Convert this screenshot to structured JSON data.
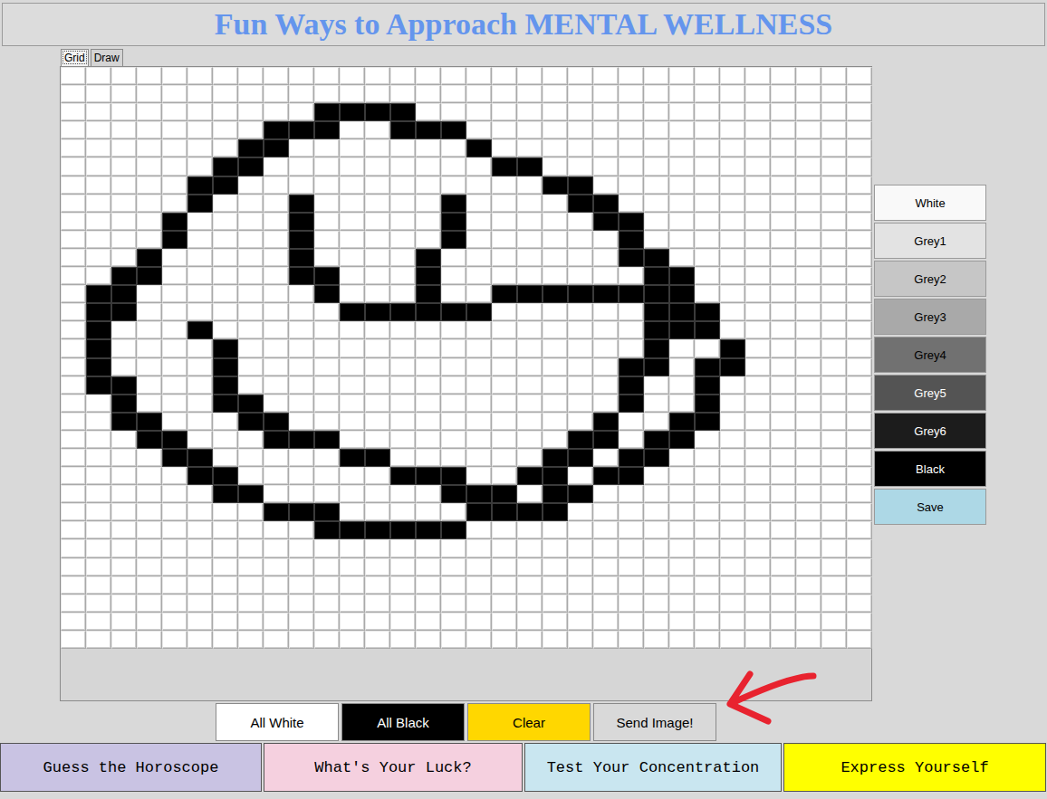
{
  "title": "Fun Ways to Approach MENTAL WELLNESS",
  "tabs": [
    {
      "label": "Grid",
      "selected": true
    },
    {
      "label": "Draw",
      "selected": false
    }
  ],
  "palette": [
    {
      "label": "White",
      "color": "#f9f9f9"
    },
    {
      "label": "Grey1",
      "color": "#e3e3e3"
    },
    {
      "label": "Grey2",
      "color": "#c6c6c6"
    },
    {
      "label": "Grey3",
      "color": "#a9a9a9"
    },
    {
      "label": "Grey4",
      "color": "#717171"
    },
    {
      "label": "Grey5",
      "color": "#545454"
    },
    {
      "label": "Grey6",
      "color": "#1c1c1c"
    },
    {
      "label": "Black",
      "color": "#000000"
    },
    {
      "label": "Save",
      "color": "#add8e6"
    }
  ],
  "grid": {
    "rows": [
      [
        0,
        0,
        0,
        0,
        0,
        0,
        0,
        0,
        0,
        0,
        0,
        0,
        0,
        0,
        0,
        0,
        0,
        0,
        0,
        0,
        0,
        0,
        0,
        0,
        0,
        0,
        0,
        0,
        0,
        0,
        0,
        0
      ],
      [
        0,
        0,
        0,
        0,
        0,
        0,
        0,
        0,
        0,
        0,
        0,
        0,
        0,
        0,
        0,
        0,
        0,
        0,
        0,
        0,
        0,
        0,
        0,
        0,
        0,
        0,
        0,
        0,
        0,
        0,
        0,
        0
      ],
      [
        0,
        0,
        0,
        0,
        0,
        0,
        0,
        0,
        0,
        0,
        1,
        1,
        1,
        1,
        0,
        0,
        0,
        0,
        0,
        0,
        0,
        0,
        0,
        0,
        0,
        0,
        0,
        0,
        0,
        0,
        0,
        0
      ],
      [
        0,
        0,
        0,
        0,
        0,
        0,
        0,
        0,
        1,
        1,
        1,
        0,
        0,
        1,
        1,
        1,
        0,
        0,
        0,
        0,
        0,
        0,
        0,
        0,
        0,
        0,
        0,
        0,
        0,
        0,
        0,
        0
      ],
      [
        0,
        0,
        0,
        0,
        0,
        0,
        0,
        1,
        1,
        0,
        0,
        0,
        0,
        0,
        0,
        0,
        1,
        0,
        0,
        0,
        0,
        0,
        0,
        0,
        0,
        0,
        0,
        0,
        0,
        0,
        0,
        0
      ],
      [
        0,
        0,
        0,
        0,
        0,
        0,
        1,
        1,
        0,
        0,
        0,
        0,
        0,
        0,
        0,
        0,
        0,
        1,
        1,
        0,
        0,
        0,
        0,
        0,
        0,
        0,
        0,
        0,
        0,
        0,
        0,
        0
      ],
      [
        0,
        0,
        0,
        0,
        0,
        1,
        1,
        0,
        0,
        0,
        0,
        0,
        0,
        0,
        0,
        0,
        0,
        0,
        0,
        1,
        1,
        0,
        0,
        0,
        0,
        0,
        0,
        0,
        0,
        0,
        0,
        0
      ],
      [
        0,
        0,
        0,
        0,
        0,
        1,
        0,
        0,
        0,
        1,
        0,
        0,
        0,
        0,
        0,
        1,
        0,
        0,
        0,
        0,
        1,
        1,
        0,
        0,
        0,
        0,
        0,
        0,
        0,
        0,
        0,
        0
      ],
      [
        0,
        0,
        0,
        0,
        1,
        0,
        0,
        0,
        0,
        1,
        0,
        0,
        0,
        0,
        0,
        1,
        0,
        0,
        0,
        0,
        0,
        1,
        1,
        0,
        0,
        0,
        0,
        0,
        0,
        0,
        0,
        0
      ],
      [
        0,
        0,
        0,
        0,
        1,
        0,
        0,
        0,
        0,
        1,
        0,
        0,
        0,
        0,
        0,
        1,
        0,
        0,
        0,
        0,
        0,
        0,
        1,
        0,
        0,
        0,
        0,
        0,
        0,
        0,
        0,
        0
      ],
      [
        0,
        0,
        0,
        1,
        0,
        0,
        0,
        0,
        0,
        1,
        0,
        0,
        0,
        0,
        1,
        0,
        0,
        0,
        0,
        0,
        0,
        0,
        1,
        1,
        0,
        0,
        0,
        0,
        0,
        0,
        0,
        0
      ],
      [
        0,
        0,
        1,
        1,
        0,
        0,
        0,
        0,
        0,
        1,
        1,
        0,
        0,
        0,
        1,
        0,
        0,
        0,
        0,
        0,
        0,
        0,
        0,
        1,
        1,
        0,
        0,
        0,
        0,
        0,
        0,
        0
      ],
      [
        0,
        1,
        1,
        0,
        0,
        0,
        0,
        0,
        0,
        0,
        1,
        0,
        0,
        0,
        1,
        0,
        0,
        1,
        1,
        1,
        1,
        1,
        1,
        1,
        1,
        0,
        0,
        0,
        0,
        0,
        0,
        0
      ],
      [
        0,
        1,
        1,
        0,
        0,
        0,
        0,
        0,
        0,
        0,
        0,
        1,
        1,
        1,
        1,
        1,
        1,
        0,
        0,
        0,
        0,
        0,
        0,
        1,
        1,
        1,
        0,
        0,
        0,
        0,
        0,
        0
      ],
      [
        0,
        1,
        0,
        0,
        0,
        1,
        0,
        0,
        0,
        0,
        0,
        0,
        0,
        0,
        0,
        0,
        0,
        0,
        0,
        0,
        0,
        0,
        0,
        1,
        1,
        1,
        0,
        0,
        0,
        0,
        0,
        0
      ],
      [
        0,
        1,
        0,
        0,
        0,
        0,
        1,
        0,
        0,
        0,
        0,
        0,
        0,
        0,
        0,
        0,
        0,
        0,
        0,
        0,
        0,
        0,
        0,
        1,
        0,
        0,
        1,
        0,
        0,
        0,
        0,
        0
      ],
      [
        0,
        1,
        0,
        0,
        0,
        0,
        1,
        0,
        0,
        0,
        0,
        0,
        0,
        0,
        0,
        0,
        0,
        0,
        0,
        0,
        0,
        0,
        1,
        1,
        0,
        1,
        1,
        0,
        0,
        0,
        0,
        0
      ],
      [
        0,
        1,
        1,
        0,
        0,
        0,
        1,
        0,
        0,
        0,
        0,
        0,
        0,
        0,
        0,
        0,
        0,
        0,
        0,
        0,
        0,
        0,
        1,
        0,
        0,
        1,
        0,
        0,
        0,
        0,
        0,
        0
      ],
      [
        0,
        0,
        1,
        0,
        0,
        0,
        1,
        1,
        0,
        0,
        0,
        0,
        0,
        0,
        0,
        0,
        0,
        0,
        0,
        0,
        0,
        0,
        1,
        0,
        0,
        1,
        0,
        0,
        0,
        0,
        0,
        0
      ],
      [
        0,
        0,
        1,
        1,
        0,
        0,
        0,
        1,
        1,
        0,
        0,
        0,
        0,
        0,
        0,
        0,
        0,
        0,
        0,
        0,
        0,
        1,
        0,
        0,
        1,
        1,
        0,
        0,
        0,
        0,
        0,
        0
      ],
      [
        0,
        0,
        0,
        1,
        1,
        0,
        0,
        0,
        1,
        1,
        1,
        0,
        0,
        0,
        0,
        0,
        0,
        0,
        0,
        0,
        1,
        1,
        0,
        1,
        1,
        0,
        0,
        0,
        0,
        0,
        0,
        0
      ],
      [
        0,
        0,
        0,
        0,
        1,
        1,
        0,
        0,
        0,
        0,
        0,
        1,
        1,
        0,
        0,
        0,
        0,
        0,
        0,
        1,
        1,
        0,
        1,
        1,
        0,
        0,
        0,
        0,
        0,
        0,
        0,
        0
      ],
      [
        0,
        0,
        0,
        0,
        0,
        1,
        1,
        0,
        0,
        0,
        0,
        0,
        0,
        1,
        1,
        1,
        0,
        0,
        1,
        1,
        0,
        1,
        1,
        0,
        0,
        0,
        0,
        0,
        0,
        0,
        0,
        0
      ],
      [
        0,
        0,
        0,
        0,
        0,
        0,
        1,
        1,
        0,
        0,
        0,
        0,
        0,
        0,
        0,
        1,
        1,
        1,
        0,
        1,
        1,
        0,
        0,
        0,
        0,
        0,
        0,
        0,
        0,
        0,
        0,
        0
      ],
      [
        0,
        0,
        0,
        0,
        0,
        0,
        0,
        0,
        1,
        1,
        1,
        0,
        0,
        0,
        0,
        0,
        1,
        1,
        1,
        1,
        0,
        0,
        0,
        0,
        0,
        0,
        0,
        0,
        0,
        0,
        0,
        0
      ],
      [
        0,
        0,
        0,
        0,
        0,
        0,
        0,
        0,
        0,
        0,
        1,
        1,
        1,
        1,
        1,
        1,
        0,
        0,
        0,
        0,
        0,
        0,
        0,
        0,
        0,
        0,
        0,
        0,
        0,
        0,
        0,
        0
      ],
      [
        0,
        0,
        0,
        0,
        0,
        0,
        0,
        0,
        0,
        0,
        0,
        0,
        0,
        0,
        0,
        0,
        0,
        0,
        0,
        0,
        0,
        0,
        0,
        0,
        0,
        0,
        0,
        0,
        0,
        0,
        0,
        0
      ],
      [
        0,
        0,
        0,
        0,
        0,
        0,
        0,
        0,
        0,
        0,
        0,
        0,
        0,
        0,
        0,
        0,
        0,
        0,
        0,
        0,
        0,
        0,
        0,
        0,
        0,
        0,
        0,
        0,
        0,
        0,
        0,
        0
      ],
      [
        0,
        0,
        0,
        0,
        0,
        0,
        0,
        0,
        0,
        0,
        0,
        0,
        0,
        0,
        0,
        0,
        0,
        0,
        0,
        0,
        0,
        0,
        0,
        0,
        0,
        0,
        0,
        0,
        0,
        0,
        0,
        0
      ],
      [
        0,
        0,
        0,
        0,
        0,
        0,
        0,
        0,
        0,
        0,
        0,
        0,
        0,
        0,
        0,
        0,
        0,
        0,
        0,
        0,
        0,
        0,
        0,
        0,
        0,
        0,
        0,
        0,
        0,
        0,
        0,
        0
      ],
      [
        0,
        0,
        0,
        0,
        0,
        0,
        0,
        0,
        0,
        0,
        0,
        0,
        0,
        0,
        0,
        0,
        0,
        0,
        0,
        0,
        0,
        0,
        0,
        0,
        0,
        0,
        0,
        0,
        0,
        0,
        0,
        0
      ],
      [
        0,
        0,
        0,
        0,
        0,
        0,
        0,
        0,
        0,
        0,
        0,
        0,
        0,
        0,
        0,
        0,
        0,
        0,
        0,
        0,
        0,
        0,
        0,
        0,
        0,
        0,
        0,
        0,
        0,
        0,
        0,
        0
      ]
    ]
  },
  "controls": [
    {
      "label": "All White",
      "color": "#ffffff"
    },
    {
      "label": "All Black",
      "color": "#000000"
    },
    {
      "label": "Clear",
      "color": "#ffd700"
    },
    {
      "label": "Send Image!",
      "color": "#d9d9d9"
    }
  ],
  "nav": [
    {
      "label": "Guess the Horoscope",
      "color": "#c9c3e3"
    },
    {
      "label": "What's Your Luck?",
      "color": "#f5d0df"
    },
    {
      "label": "Test Your Concentration",
      "color": "#c9e6f0"
    },
    {
      "label": "Express Yourself",
      "color": "#ffff00"
    }
  ]
}
